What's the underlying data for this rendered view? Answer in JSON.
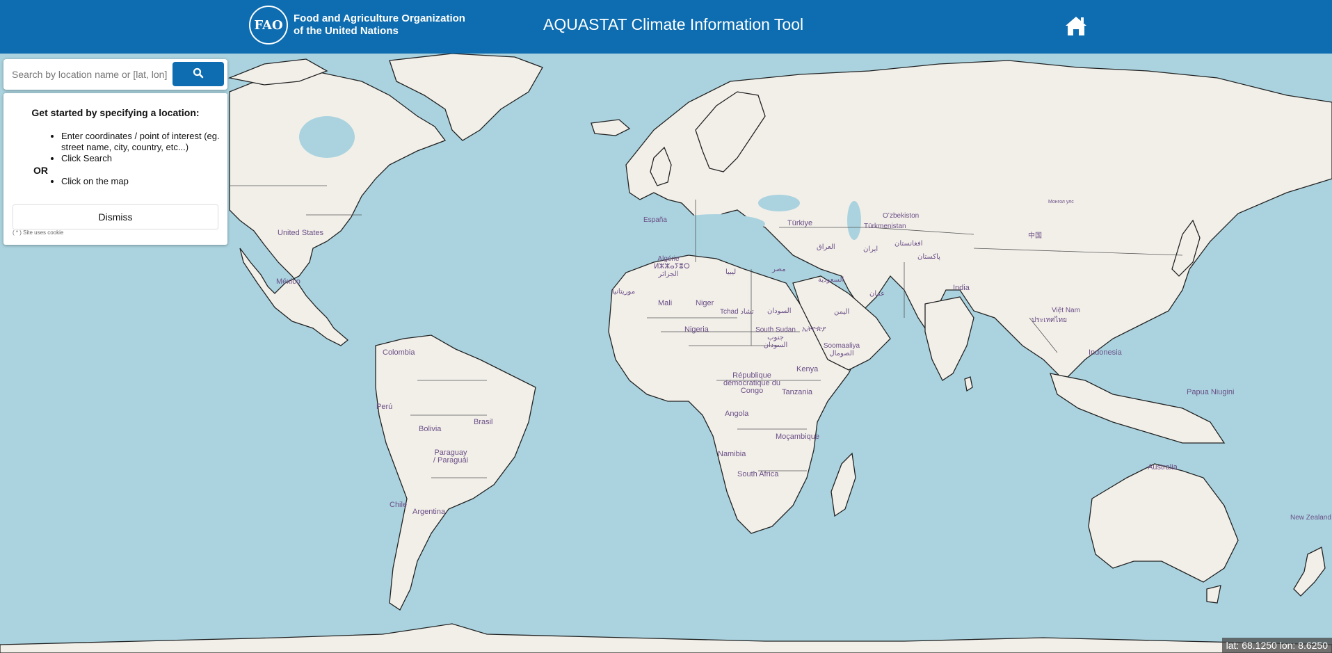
{
  "header": {
    "org_name_line1": "Food and Agriculture Organization",
    "org_name_line2": "of the United Nations",
    "logo_letters": "FAO",
    "app_title": "AQUASTAT Climate Information Tool",
    "home_icon": "home-icon"
  },
  "search": {
    "placeholder": "Search by location name or [lat, lon]",
    "button_icon": "search-icon"
  },
  "panel": {
    "title": "Get started by specifying a location:",
    "steps": [
      "Enter coordinates / point of interest (eg. street name, city, country, etc...)",
      "Click Search"
    ],
    "or_label": "OR",
    "alt_steps": [
      "Click on the map"
    ],
    "dismiss_label": "Dismiss",
    "cookie_note": "( * ) Site uses cookie"
  },
  "map": {
    "labels": {
      "united_states": "United States",
      "mexico": "México",
      "colombia": "Colombia",
      "peru": "Perú",
      "bolivia": "Bolivia",
      "brasil": "Brasil",
      "paraguay": "Paraguay / Paraguái",
      "chile": "Chile",
      "argentina": "Argentina",
      "espana": "España",
      "algerie": "Algérie ⵍⵣⵣⴰⵢⴻⵔ الجزائر",
      "libya": "ليبيا",
      "misr": "مصر",
      "mauritania": "موريتانيا",
      "mali": "Mali",
      "niger": "Niger",
      "tchad": "Tchad تشاد",
      "sudan": "السودان",
      "nigeria": "Nigeria",
      "south_sudan": "South Sudan جنوب السودان",
      "ethiopia": "ኢትዮጵያ",
      "somalia": "Soomaaliya الصومال",
      "rdc": "République démocratique du Congo",
      "kenya": "Kenya",
      "tanzania": "Tanzania",
      "angola": "Angola",
      "namibia": "Namibia",
      "mocambique": "Moçambique",
      "south_africa": "South Africa",
      "turkiye": "Türkiye",
      "iraq": "العراق",
      "iran": "ایران",
      "saudi": "السعودية",
      "yemen": "اليمن",
      "oman": "عمان",
      "turkmenistan": "Türkmenistan",
      "ozbekiston": "Oʻzbekiston",
      "afghanistan": "افغانستان",
      "pakistan": "پاکستان",
      "india": "India",
      "china": "中国",
      "mongolia": "Монгол улс",
      "vietnam": "Việt Nam",
      "thailand": "ประเทศไทย",
      "indonesia": "Indonesia",
      "png": "Papua Niugini",
      "australia": "Australia",
      "new_zealand": "New Zealand"
    },
    "coordinates": {
      "lat_label": "lat:",
      "lat": "68.1250",
      "lon_label": "lon:",
      "lon": "8.6250"
    }
  }
}
